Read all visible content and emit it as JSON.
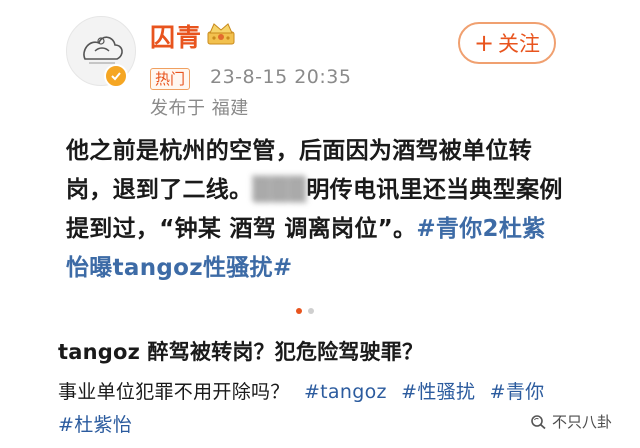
{
  "post": {
    "username": "囚青",
    "hot_label": "热门",
    "timestamp": "23-8-15 20:35",
    "location": "发布于 福建",
    "follow_label": "关注",
    "follow_icon": "plus-icon",
    "body_part1": "他之前是杭州的空管，后面因为酒驾被单位转岗，退到了二线。",
    "body_blurred": "▒▒▒",
    "body_part2": "明传电讯里还当典型案例提到过，“钟某 酒驾 调离岗位”。",
    "hashtag": "#青你2杜紫怡曝tangoz性骚扰#",
    "carousel_active_index": 0,
    "carousel_count": 2
  },
  "article": {
    "title": "tangoz 醉驾被转岗？犯危险驾驶罪？",
    "line1_text": "事业单位犯罪不用开除吗？",
    "tags_line1": [
      "#tangoz",
      "#性骚扰",
      "#青你"
    ],
    "tags_line2": [
      "#杜紫怡"
    ]
  },
  "watermark": {
    "text": "不只八卦",
    "icon": "wechat-search-icon"
  },
  "colors": {
    "accent": "#e8541e",
    "link": "#3d6ba6",
    "muted": "#8a8a8a"
  }
}
